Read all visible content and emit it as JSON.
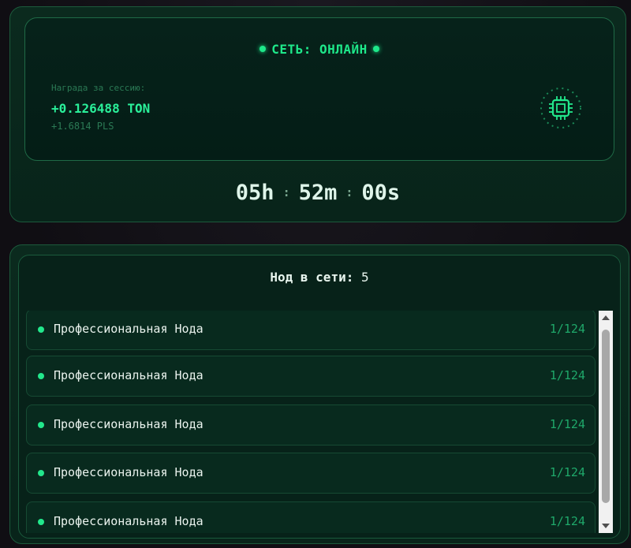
{
  "session": {
    "status_label": "СЕТЬ: ОНЛАЙН",
    "reward_label": "Награда за сессию:",
    "reward_ton": "+0.126488 TON",
    "reward_pls": "+1.6814 PLS",
    "chip_icon": "cpu-chip-icon"
  },
  "timer": {
    "hours": "05h",
    "minutes": "52m",
    "seconds": "00s",
    "separator": ":"
  },
  "nodes": {
    "title": "Нод в сети:",
    "count": "5",
    "items": [
      {
        "name": "Профессиональная Нода",
        "ratio": "1/124"
      },
      {
        "name": "Профессиональная Нода",
        "ratio": "1/124"
      },
      {
        "name": "Профессиональная Нода",
        "ratio": "1/124"
      },
      {
        "name": "Профессиональная Нода",
        "ratio": "1/124"
      },
      {
        "name": "Профессиональная Нода",
        "ratio": "1/124"
      }
    ]
  },
  "colors": {
    "accent": "#1ee88a",
    "background": "#120f14",
    "panel": "#0b2a1e"
  }
}
